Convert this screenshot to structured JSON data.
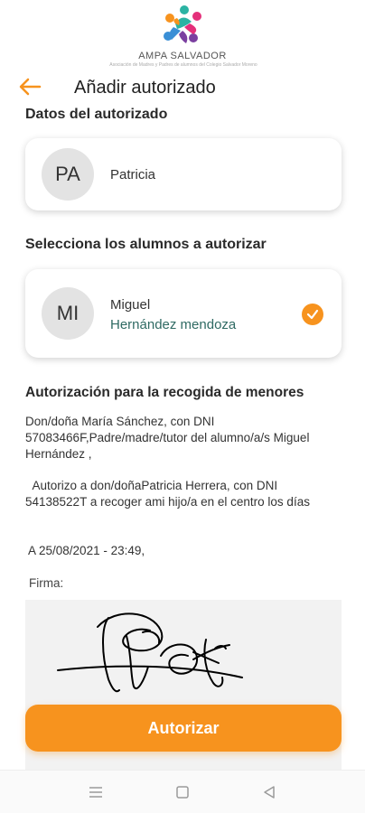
{
  "brand": {
    "name": "AMPA SALVADOR",
    "tagline": "Asociación de Madres y Padres de alumnos del Colegio Salvador Moreno"
  },
  "header": {
    "title": "Añadir autorizado"
  },
  "authorized_section": {
    "label": "Datos del autorizado",
    "person": {
      "initials": "PA",
      "name": "Patricia"
    }
  },
  "students_section": {
    "label": "Selecciona los alumnos a autorizar",
    "student": {
      "initials": "MI",
      "first_name": "Miguel",
      "last_name": "Hernández mendoza",
      "selected": true
    }
  },
  "authorization": {
    "title": "Autorización para la recogida de menores",
    "paragraph1": "Don/doña María Sánchez, con DNI 57083466F,Padre/madre/tutor del alumno/a/s Miguel Hernández ,",
    "paragraph2": "  Autorizo a don/doñaPatricia Herrera, con DNI 54138522T a recoger ami hijo/a en el centro los días",
    "date": " A 25/08/2021 - 23:49,",
    "signature_label": "Firma:"
  },
  "actions": {
    "authorize_label": "Autorizar"
  },
  "colors": {
    "accent": "#f7931e",
    "teal_text": "#2f6a63"
  },
  "system_nav": {
    "icons": [
      "menu-icon",
      "home-square-icon",
      "back-triangle-icon"
    ]
  }
}
